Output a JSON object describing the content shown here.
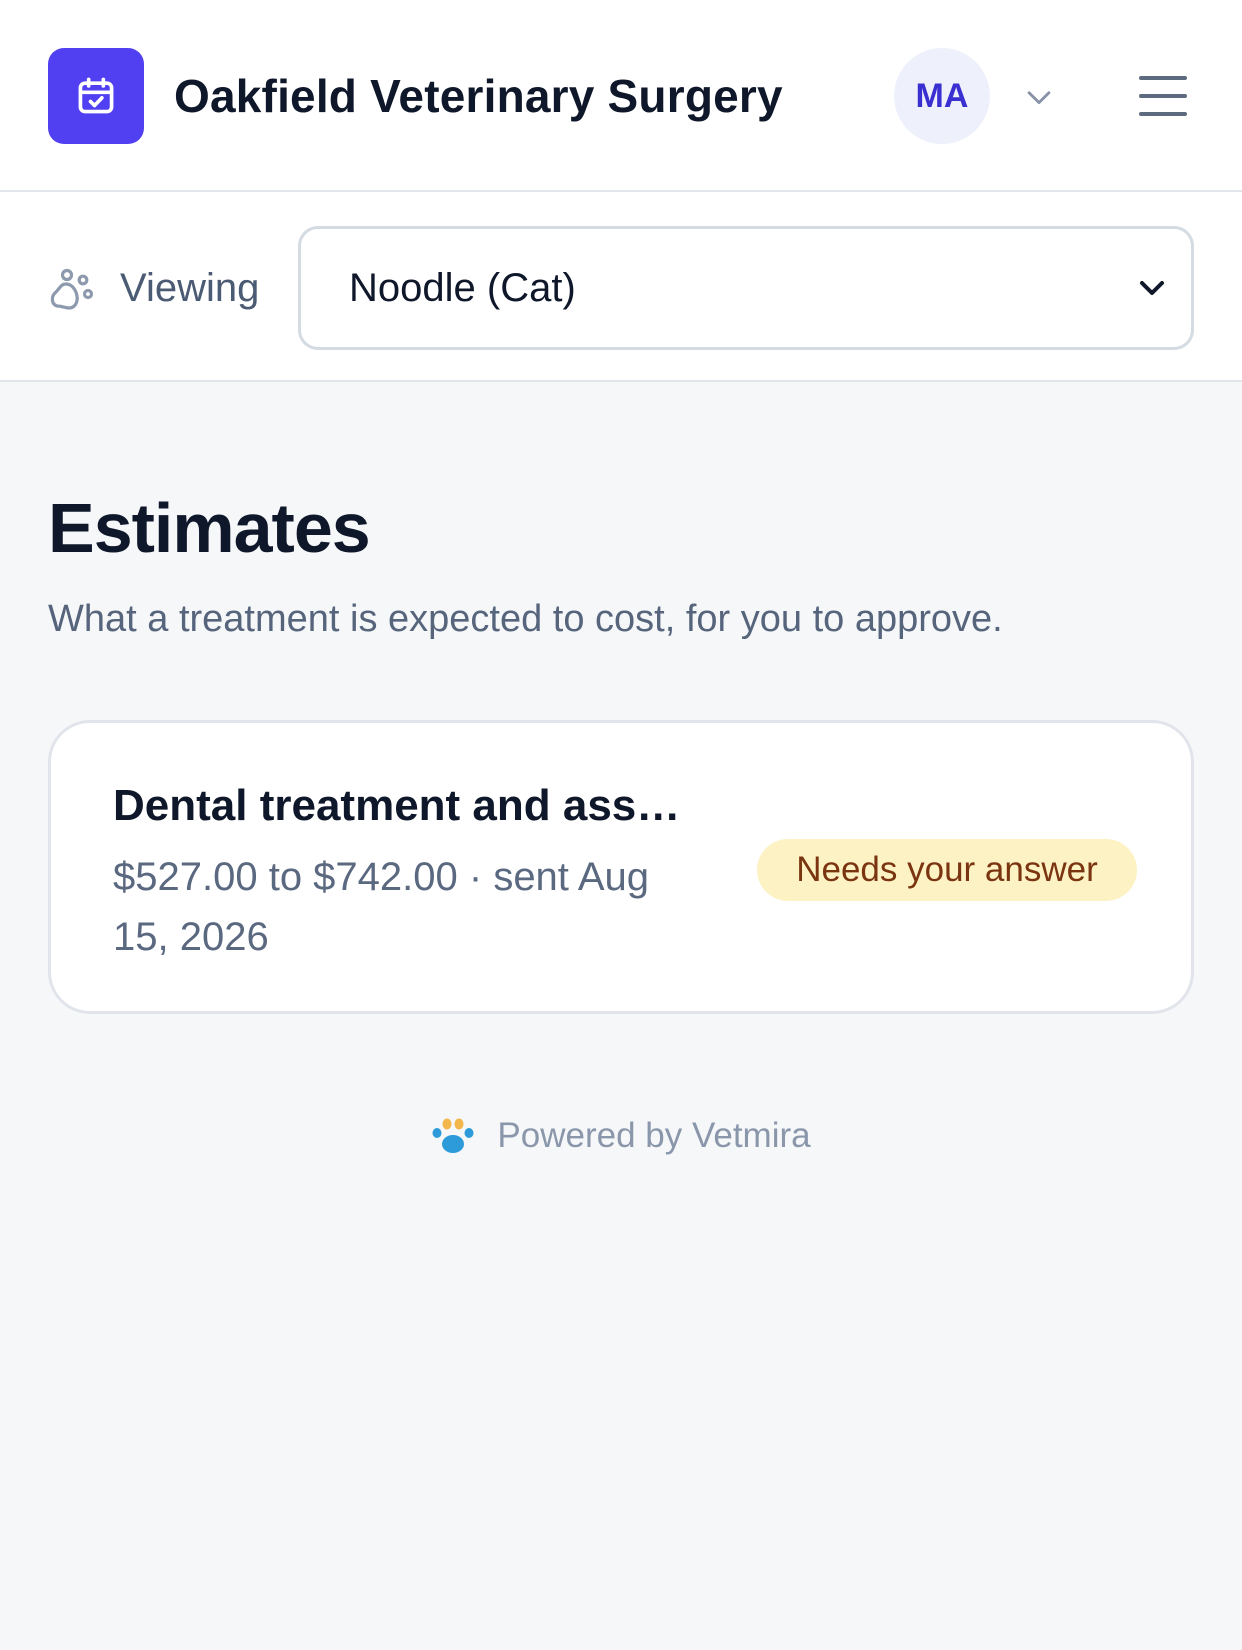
{
  "header": {
    "clinic_name": "Oakfield Veterinary Surgery",
    "logo_icon": "calendar-check-icon",
    "avatar_initials": "MA",
    "account_menu_icon": "chevron-down-icon",
    "menu_icon": "hamburger-menu-icon"
  },
  "viewing": {
    "icon": "paw-icon",
    "label": "Viewing",
    "selected_pet": "Noodle (Cat)",
    "options": [
      "Noodle (Cat)"
    ]
  },
  "main": {
    "title": "Estimates",
    "subtitle": "What a treatment is expected to cost, for you to approve.",
    "estimates": [
      {
        "title": "Dental treatment and ass…",
        "meta": "$527.00 to $742.00 · sent Aug 15, 2026",
        "status": "Needs your answer"
      }
    ]
  },
  "footer": {
    "text": "Powered by Vetmira",
    "icon": "paw-icon"
  },
  "colors": {
    "brand": "#5140f2",
    "avatar_text": "#3a2fd0",
    "badge_bg": "#fdf2c4",
    "badge_text": "#7a3410",
    "page_bg": "#f6f7f9"
  }
}
